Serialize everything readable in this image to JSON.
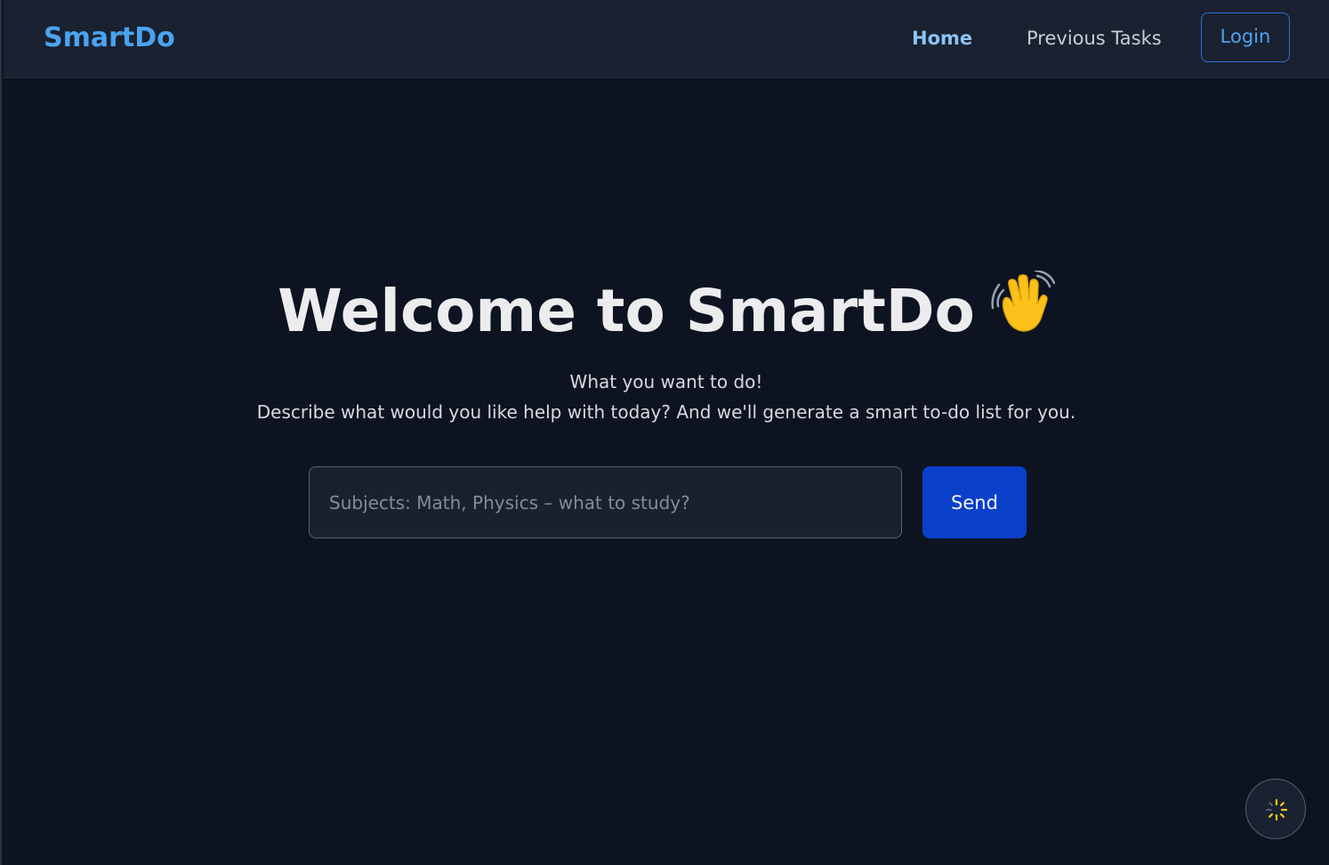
{
  "header": {
    "brand": "SmartDo",
    "nav": {
      "home": "Home",
      "previous_tasks": "Previous Tasks",
      "login": "Login"
    }
  },
  "hero": {
    "title": "Welcome to SmartDo",
    "emoji_icon": "waving-hand-icon",
    "subtitle_line1": "What you want to do!",
    "subtitle_line2": "Describe what would you like help with today? And we'll generate a smart to-do list for you."
  },
  "form": {
    "input_value": "",
    "input_placeholder": "Subjects: Math, Physics – what to study?",
    "send_label": "Send"
  },
  "fab": {
    "icon": "loading-spinner-icon"
  },
  "colors": {
    "background": "#0d1320",
    "navbar": "#1a2130",
    "accent": "#4aa3f0",
    "send_button": "#0a3fca",
    "spinner": "#f5c518"
  }
}
